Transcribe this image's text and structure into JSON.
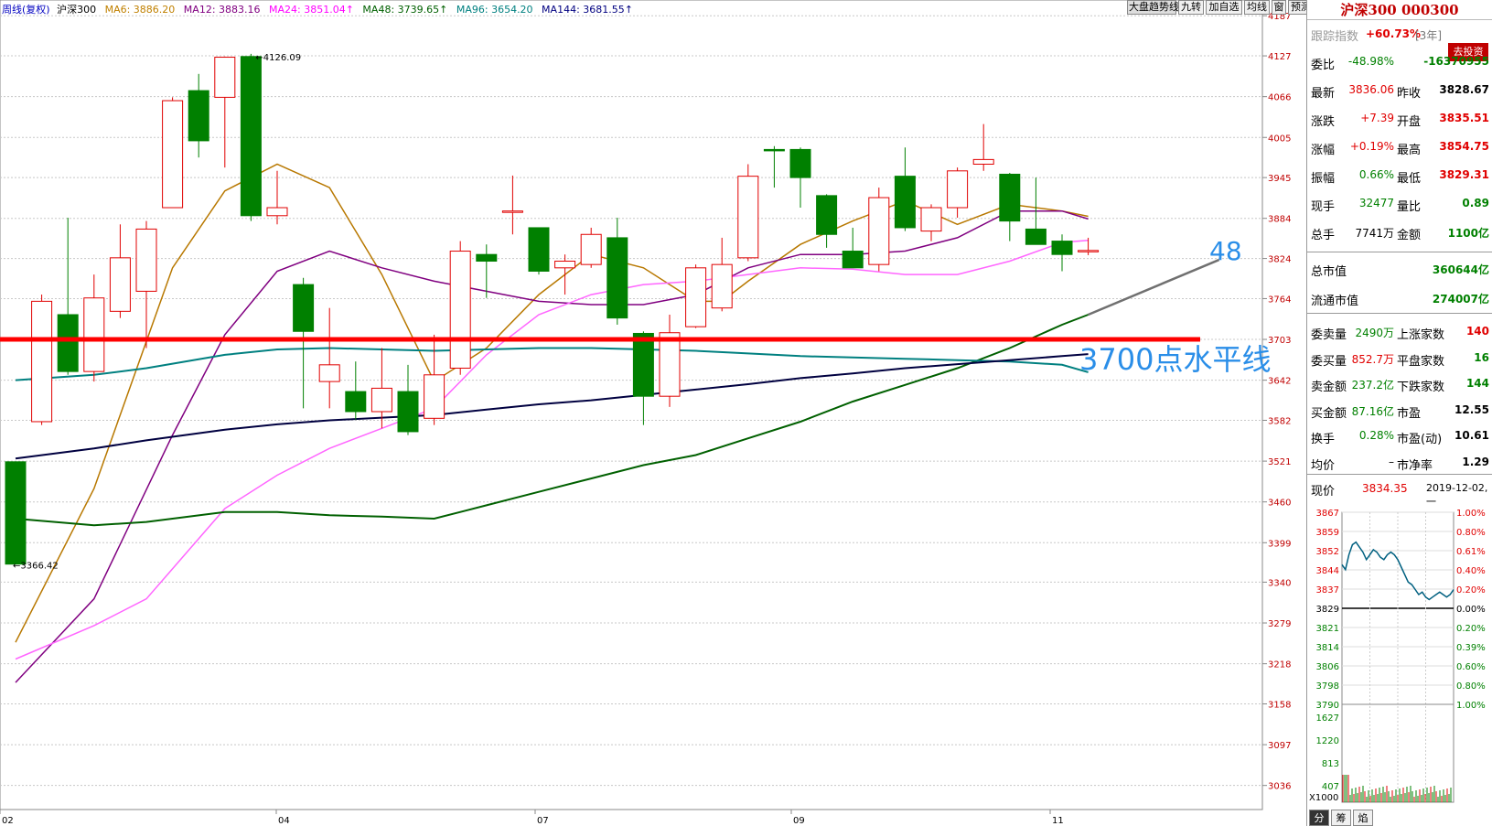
{
  "header": {
    "period_label": "周线(复权)",
    "index_name": "沪深300",
    "ma_items": [
      {
        "label": "MA6: 3886.20",
        "color": "#c08000"
      },
      {
        "label": "MA12: 3883.16",
        "color": "#800080"
      },
      {
        "label": "MA24: 3851.04↑",
        "color": "#ff00ff"
      },
      {
        "label": "MA48: 3739.65↑",
        "color": "#006000"
      },
      {
        "label": "MA96: 3654.20",
        "color": "#008080"
      },
      {
        "label": "MA144: 3681.55↑",
        "color": "#000080"
      }
    ]
  },
  "toolbar": [
    "大盘趋势线",
    "九转",
    "加自选",
    "均线",
    "窗",
    "预测"
  ],
  "annotations": {
    "line48": "48",
    "line3700": "3700点水平线"
  },
  "chart_data": {
    "type": "candlestick",
    "ylim": [
      3000,
      4190
    ],
    "y_ticks": [
      "4187",
      "4127",
      "4066",
      "4005",
      "3945",
      "3884",
      "3824",
      "3764",
      "3703",
      "3642",
      "3582",
      "3521",
      "3460",
      "3399",
      "3340",
      "3279",
      "3218",
      "3158",
      "3097",
      "3036"
    ],
    "x_labels": [
      "02",
      "04",
      "07",
      "09",
      "11"
    ],
    "max_label": "4126.09",
    "min_label": "3366.42",
    "candles": [
      {
        "o": 3520,
        "c": 3367,
        "h": 3520,
        "l": 3366
      },
      {
        "o": 3580,
        "c": 3760,
        "h": 3770,
        "l": 3575
      },
      {
        "o": 3740,
        "c": 3655,
        "h": 3885,
        "l": 3650
      },
      {
        "o": 3655,
        "c": 3765,
        "h": 3800,
        "l": 3640
      },
      {
        "o": 3745,
        "c": 3825,
        "h": 3875,
        "l": 3735
      },
      {
        "o": 3775,
        "c": 3868,
        "h": 3880,
        "l": 3690
      },
      {
        "o": 3900,
        "c": 4060,
        "h": 4065,
        "l": 3900
      },
      {
        "o": 4075,
        "c": 4000,
        "h": 4100,
        "l": 3975
      },
      {
        "o": 4065,
        "c": 4125,
        "h": 4126,
        "l": 3960
      },
      {
        "o": 4126,
        "c": 3888,
        "h": 4130,
        "l": 3880
      },
      {
        "o": 3888,
        "c": 3900,
        "h": 3955,
        "l": 3875
      },
      {
        "o": 3785,
        "c": 3715,
        "h": 3795,
        "l": 3600
      },
      {
        "o": 3640,
        "c": 3665,
        "h": 3750,
        "l": 3600
      },
      {
        "o": 3625,
        "c": 3595,
        "h": 3670,
        "l": 3583
      },
      {
        "o": 3595,
        "c": 3630,
        "h": 3690,
        "l": 3570
      },
      {
        "o": 3625,
        "c": 3565,
        "h": 3665,
        "l": 3560
      },
      {
        "o": 3585,
        "c": 3650,
        "h": 3710,
        "l": 3575
      },
      {
        "o": 3660,
        "c": 3835,
        "h": 3850,
        "l": 3650
      },
      {
        "o": 3830,
        "c": 3820,
        "h": 3845,
        "l": 3765
      },
      {
        "o": 3895,
        "c": 3895,
        "h": 3948,
        "l": 3860
      },
      {
        "o": 3870,
        "c": 3805,
        "h": 3870,
        "l": 3800
      },
      {
        "o": 3810,
        "c": 3820,
        "h": 3830,
        "l": 3770
      },
      {
        "o": 3815,
        "c": 3860,
        "h": 3870,
        "l": 3810
      },
      {
        "o": 3855,
        "c": 3735,
        "h": 3885,
        "l": 3725
      },
      {
        "o": 3712,
        "c": 3618,
        "h": 3715,
        "l": 3575
      },
      {
        "o": 3618,
        "c": 3713,
        "h": 3740,
        "l": 3602
      },
      {
        "o": 3722,
        "c": 3810,
        "h": 3815,
        "l": 3720
      },
      {
        "o": 3750,
        "c": 3815,
        "h": 3855,
        "l": 3745
      },
      {
        "o": 3825,
        "c": 3947,
        "h": 3965,
        "l": 3820
      },
      {
        "o": 3987,
        "c": 3985,
        "h": 3992,
        "l": 3930
      },
      {
        "o": 3987,
        "c": 3945,
        "h": 3990,
        "l": 3900
      },
      {
        "o": 3918,
        "c": 3860,
        "h": 3920,
        "l": 3840
      },
      {
        "o": 3835,
        "c": 3810,
        "h": 3870,
        "l": 3810
      },
      {
        "o": 3815,
        "c": 3915,
        "h": 3930,
        "l": 3805
      },
      {
        "o": 3947,
        "c": 3870,
        "h": 3990,
        "l": 3865
      },
      {
        "o": 3865,
        "c": 3900,
        "h": 3905,
        "l": 3850
      },
      {
        "o": 3900,
        "c": 3955,
        "h": 3960,
        "l": 3885
      },
      {
        "o": 3965,
        "c": 3972,
        "h": 4025,
        "l": 3955
      },
      {
        "o": 3950,
        "c": 3880,
        "h": 3952,
        "l": 3850
      },
      {
        "o": 3868,
        "c": 3845,
        "h": 3945,
        "l": 3845
      },
      {
        "o": 3850,
        "c": 3830,
        "h": 3860,
        "l": 3805
      },
      {
        "o": 3834,
        "c": 3836,
        "h": 3855,
        "l": 3829
      }
    ],
    "series": [
      {
        "name": "MA6",
        "color": "#b87800",
        "points": [
          [
            0,
            3250
          ],
          [
            3,
            3480
          ],
          [
            6,
            3810
          ],
          [
            8,
            3925
          ],
          [
            10,
            3965
          ],
          [
            12,
            3930
          ],
          [
            14,
            3800
          ],
          [
            16,
            3640
          ],
          [
            18,
            3690
          ],
          [
            20,
            3770
          ],
          [
            22,
            3830
          ],
          [
            24,
            3810
          ],
          [
            26,
            3760
          ],
          [
            27,
            3760
          ],
          [
            28,
            3790
          ],
          [
            30,
            3845
          ],
          [
            32,
            3880
          ],
          [
            34,
            3910
          ],
          [
            36,
            3875
          ],
          [
            38,
            3905
          ],
          [
            40,
            3895
          ],
          [
            41,
            3887
          ]
        ]
      },
      {
        "name": "MA12",
        "color": "#800080",
        "points": [
          [
            0,
            3190
          ],
          [
            3,
            3315
          ],
          [
            6,
            3560
          ],
          [
            8,
            3710
          ],
          [
            10,
            3805
          ],
          [
            12,
            3835
          ],
          [
            14,
            3810
          ],
          [
            16,
            3790
          ],
          [
            18,
            3775
          ],
          [
            20,
            3760
          ],
          [
            22,
            3755
          ],
          [
            24,
            3755
          ],
          [
            26,
            3770
          ],
          [
            28,
            3810
          ],
          [
            30,
            3830
          ],
          [
            32,
            3830
          ],
          [
            34,
            3835
          ],
          [
            36,
            3855
          ],
          [
            38,
            3895
          ],
          [
            40,
            3895
          ],
          [
            41,
            3883
          ]
        ]
      },
      {
        "name": "MA24",
        "color": "#ff66ff",
        "points": [
          [
            0,
            3225
          ],
          [
            3,
            3275
          ],
          [
            5,
            3315
          ],
          [
            8,
            3450
          ],
          [
            10,
            3500
          ],
          [
            12,
            3540
          ],
          [
            14,
            3570
          ],
          [
            16,
            3600
          ],
          [
            18,
            3680
          ],
          [
            20,
            3740
          ],
          [
            22,
            3770
          ],
          [
            24,
            3785
          ],
          [
            26,
            3790
          ],
          [
            28,
            3800
          ],
          [
            30,
            3810
          ],
          [
            32,
            3808
          ],
          [
            34,
            3800
          ],
          [
            36,
            3800
          ],
          [
            38,
            3820
          ],
          [
            40,
            3848
          ],
          [
            41,
            3851
          ]
        ]
      },
      {
        "name": "MA48",
        "color": "#006000",
        "points": [
          [
            0,
            3435
          ],
          [
            3,
            3425
          ],
          [
            5,
            3430
          ],
          [
            8,
            3445
          ],
          [
            10,
            3445
          ],
          [
            12,
            3440
          ],
          [
            14,
            3438
          ],
          [
            16,
            3435
          ],
          [
            18,
            3455
          ],
          [
            20,
            3475
          ],
          [
            22,
            3495
          ],
          [
            24,
            3515
          ],
          [
            26,
            3530
          ],
          [
            28,
            3555
          ],
          [
            30,
            3580
          ],
          [
            32,
            3610
          ],
          [
            34,
            3635
          ],
          [
            36,
            3660
          ],
          [
            38,
            3690
          ],
          [
            40,
            3725
          ],
          [
            41,
            3740
          ]
        ]
      },
      {
        "name": "MA96",
        "color": "#008080",
        "points": [
          [
            0,
            3642
          ],
          [
            3,
            3650
          ],
          [
            5,
            3660
          ],
          [
            8,
            3680
          ],
          [
            10,
            3688
          ],
          [
            12,
            3690
          ],
          [
            14,
            3688
          ],
          [
            16,
            3686
          ],
          [
            18,
            3688
          ],
          [
            20,
            3690
          ],
          [
            22,
            3690
          ],
          [
            24,
            3688
          ],
          [
            26,
            3686
          ],
          [
            28,
            3682
          ],
          [
            30,
            3678
          ],
          [
            32,
            3676
          ],
          [
            34,
            3674
          ],
          [
            36,
            3672
          ],
          [
            38,
            3670
          ],
          [
            40,
            3665
          ],
          [
            41,
            3654
          ]
        ]
      },
      {
        "name": "MA144",
        "color": "#000040",
        "points": [
          [
            0,
            3525
          ],
          [
            3,
            3540
          ],
          [
            5,
            3552
          ],
          [
            8,
            3568
          ],
          [
            10,
            3576
          ],
          [
            12,
            3582
          ],
          [
            14,
            3586
          ],
          [
            16,
            3590
          ],
          [
            18,
            3598
          ],
          [
            20,
            3606
          ],
          [
            22,
            3612
          ],
          [
            24,
            3620
          ],
          [
            26,
            3628
          ],
          [
            28,
            3636
          ],
          [
            30,
            3645
          ],
          [
            32,
            3652
          ],
          [
            34,
            3660
          ],
          [
            36,
            3666
          ],
          [
            38,
            3672
          ],
          [
            40,
            3678
          ],
          [
            41,
            3681
          ]
        ]
      }
    ],
    "trend_line": {
      "color": "#707070",
      "points": [
        [
          41,
          3740
        ],
        [
          46,
          3822
        ]
      ]
    },
    "horizontal_line": {
      "value": 3703,
      "color": "#ff0000"
    }
  },
  "panel": {
    "title": "沪深300 000300",
    "track_label": "跟踪指数",
    "track_value": "+60.73%",
    "track_period": "[3年]",
    "invest_btn": "去投资",
    "rows1": [
      {
        "l1": "委比",
        "v1": "-48.98%",
        "c1": "green",
        "l2": "",
        "v2": "-16370955",
        "c2": "green"
      },
      {
        "l1": "最新",
        "v1": "3836.06",
        "c1": "red",
        "l2": "昨收",
        "v2": "3828.67",
        "c2": "black"
      },
      {
        "l1": "涨跌",
        "v1": "+7.39",
        "c1": "red",
        "l2": "开盘",
        "v2": "3835.51",
        "c2": "red"
      },
      {
        "l1": "涨幅",
        "v1": "+0.19%",
        "c1": "red",
        "l2": "最高",
        "v2": "3854.75",
        "c2": "red"
      },
      {
        "l1": "振幅",
        "v1": "0.66%",
        "c1": "green",
        "l2": "最低",
        "v2": "3829.31",
        "c2": "red"
      },
      {
        "l1": "现手",
        "v1": "32477",
        "c1": "green",
        "l2": "量比",
        "v2": "0.89",
        "c2": "green"
      },
      {
        "l1": "总手",
        "v1": "7741万",
        "c1": "black",
        "l2": "金额",
        "v2": "1100亿",
        "c2": "green"
      }
    ],
    "mcap": [
      {
        "l": "总市值",
        "v": "360644亿"
      },
      {
        "l": "流通市值",
        "v": "274007亿"
      }
    ],
    "rows2": [
      {
        "l1": "委卖量",
        "v1": "2490万",
        "c1": "green",
        "l2": "上涨家数",
        "v2": "140",
        "c2": "red"
      },
      {
        "l1": "委买量",
        "v1": "852.7万",
        "c1": "red",
        "l2": "平盘家数",
        "v2": "16",
        "c2": "green"
      },
      {
        "l1": "卖金额",
        "v1": "237.2亿",
        "c1": "green",
        "l2": "下跌家数",
        "v2": "144",
        "c2": "green"
      },
      {
        "l1": "买金额",
        "v1": "87.16亿",
        "c1": "green",
        "l2": "市盈",
        "v2": "12.55",
        "c2": "black"
      },
      {
        "l1": "换手",
        "v1": "0.28%",
        "c1": "green",
        "l2": "市盈(动)",
        "v2": "10.61",
        "c2": "black"
      },
      {
        "l1": "均价",
        "v1": "–",
        "c1": "black",
        "l2": "市净率",
        "v2": "1.29",
        "c2": "black"
      }
    ],
    "now_label": "现价",
    "now_value": "3834.35",
    "date": "2019-12-02,一",
    "mini": {
      "left_ticks": [
        "3867",
        "3859",
        "3852",
        "3844",
        "3837",
        "3829",
        "3821",
        "3814",
        "3806",
        "3798",
        "3790"
      ],
      "right_ticks": [
        "1.00%",
        "0.80%",
        "0.61%",
        "0.40%",
        "0.20%",
        "0.00%",
        "0.20%",
        "0.39%",
        "0.60%",
        "0.80%",
        "1.00%"
      ],
      "vol_ticks": [
        "1627",
        "1220",
        "813",
        "407"
      ],
      "vol_unit": "X1000",
      "base": 3829,
      "price": [
        3846,
        3844,
        3850,
        3854,
        3855,
        3853,
        3851,
        3848,
        3850,
        3852,
        3851,
        3849,
        3848,
        3850,
        3851,
        3850,
        3848,
        3845,
        3842,
        3839,
        3838,
        3836,
        3834,
        3835,
        3833,
        3832,
        3833,
        3834,
        3835,
        3834,
        3833,
        3834,
        3836
      ],
      "tabs": [
        "分",
        "筹",
        "焰"
      ]
    }
  }
}
